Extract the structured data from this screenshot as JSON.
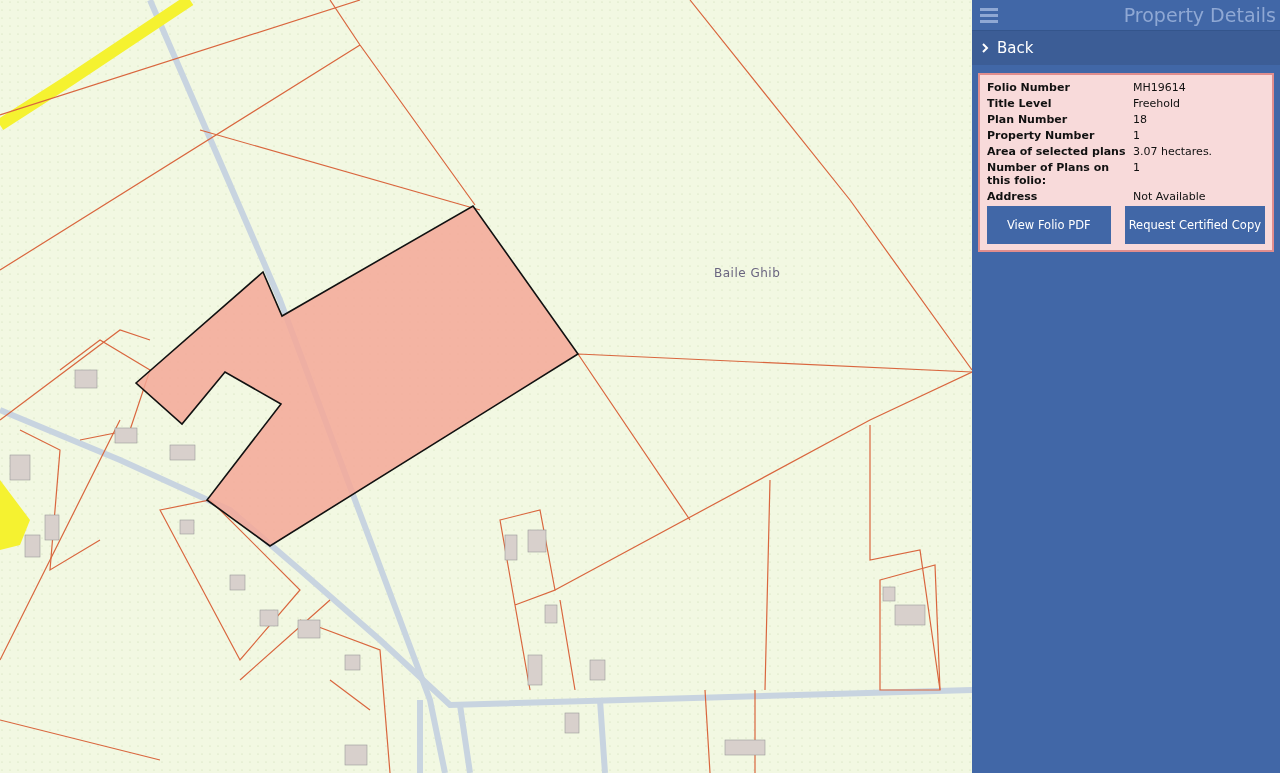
{
  "map": {
    "place_label": "Baile Ghib"
  },
  "panel": {
    "title": "Property Details",
    "back_label": "Back",
    "details": [
      {
        "label": "Folio Number",
        "value": "MH19614"
      },
      {
        "label": "Title Level",
        "value": "Freehold"
      },
      {
        "label": "Plan Number",
        "value": "18"
      },
      {
        "label": "Property Number",
        "value": "1"
      },
      {
        "label": "Area of selected plans",
        "value": "3.07 hectares."
      },
      {
        "label": "Number of Plans on this folio:",
        "value": "1"
      },
      {
        "label": "Address",
        "value": "Not Available"
      }
    ],
    "buttons": [
      "View Folio PDF",
      "Request Certified Copy"
    ]
  }
}
